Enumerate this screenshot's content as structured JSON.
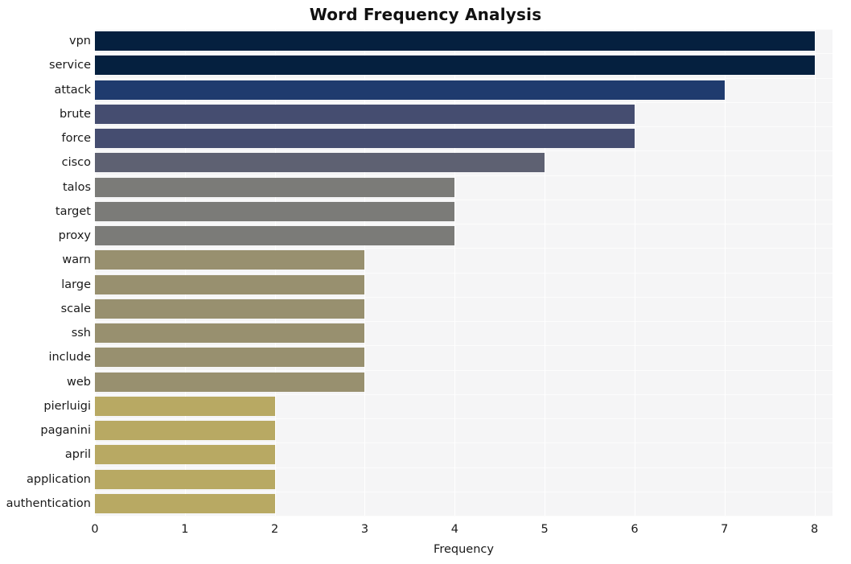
{
  "chart_data": {
    "type": "bar",
    "orientation": "horizontal",
    "title": "Word Frequency Analysis",
    "xlabel": "Frequency",
    "ylabel": "",
    "xlim": [
      0,
      8.2
    ],
    "xticks": [
      0,
      1,
      2,
      3,
      4,
      5,
      6,
      7,
      8
    ],
    "xticklabels": [
      "0",
      "1",
      "2",
      "3",
      "4",
      "5",
      "6",
      "7",
      "8"
    ],
    "grid": true,
    "legend": null,
    "categories": [
      "vpn",
      "service",
      "attack",
      "brute",
      "force",
      "cisco",
      "talos",
      "target",
      "proxy",
      "warn",
      "large",
      "scale",
      "ssh",
      "include",
      "web",
      "pierluigi",
      "paganini",
      "april",
      "application",
      "authentication"
    ],
    "values": [
      8,
      8,
      7,
      6,
      6,
      5,
      4,
      4,
      4,
      3,
      3,
      3,
      3,
      3,
      3,
      2,
      2,
      2,
      2,
      2
    ],
    "bar_colors": [
      "#05203f",
      "#05203f",
      "#1f3b6e",
      "#454d70",
      "#454d70",
      "#5e6172",
      "#7b7b78",
      "#7b7b78",
      "#7b7b78",
      "#98906f",
      "#98906f",
      "#98906f",
      "#98906f",
      "#98906f",
      "#98906f",
      "#b8a963",
      "#b8a963",
      "#b8a963",
      "#b8a963",
      "#b8a963"
    ],
    "plot_background": "#f5f5f6",
    "gridline_color": "#ffffff",
    "figure_background": "#ffffff"
  }
}
